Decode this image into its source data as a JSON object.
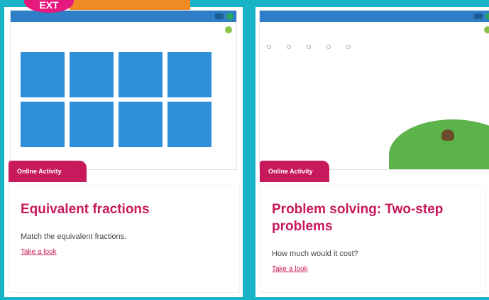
{
  "header": {
    "badge": "EXT",
    "banner": ""
  },
  "cards": [
    {
      "shot": {
        "bar_title": "",
        "pill": "",
        "question": ""
      },
      "tag": "Online Activity",
      "title": "Equivalent fractions",
      "description": "Match the equivalent fractions.",
      "link": "Take a look",
      "tiles": 8
    },
    {
      "shot": {
        "bar_title": "",
        "pill": "",
        "question": "",
        "options": [
          "",
          "",
          "",
          "",
          ""
        ]
      },
      "tag": "Online Activity",
      "title": "Problem solving: Two-step problems",
      "description": "How much would it cost?",
      "link": "Take a look"
    }
  ],
  "colors": {
    "accent": "#c8195c",
    "tile": "#2f8fd9",
    "bar": "#2f7fc8",
    "frame": "#18b4c6"
  }
}
